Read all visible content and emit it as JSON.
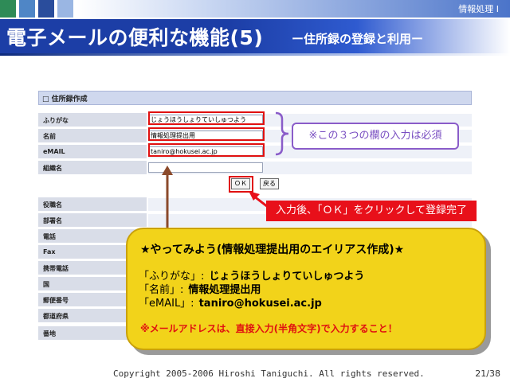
{
  "header": {
    "subject": "情報処理 I",
    "title": "電子メールの便利な機能(5)",
    "subtitle": "ー住所録の登録と利用ー",
    "square_colors": [
      "#2e8b57",
      "#4f86c6",
      "#2a4d9c",
      "#9ab6e3"
    ]
  },
  "form": {
    "section_title": "□ 住所録作成",
    "rows": [
      {
        "label": "ふりがな",
        "value": "じょうほうしょりていしゅつよう"
      },
      {
        "label": "名前",
        "value": "情報処理提出用"
      },
      {
        "label": "eMAIL",
        "value": "taniro@hokusei.ac.jp"
      },
      {
        "label": "組織名",
        "value": ""
      }
    ],
    "ok_label": "ＯＫ",
    "back_label": "戻る",
    "rows2": [
      {
        "label": "役職名"
      },
      {
        "label": "部署名"
      },
      {
        "label": "電話"
      },
      {
        "label": "Fax"
      },
      {
        "label": "携帯電話"
      },
      {
        "label": "国"
      },
      {
        "label": "郵便番号"
      },
      {
        "label": "都道府県"
      },
      {
        "label": "番地"
      }
    ]
  },
  "note": "※この３つの欄の入力は必須",
  "callout": "入力後、「ＯＫ」をクリックして登録完了",
  "exercise": {
    "title": "★やってみよう(情報処理提出用のエイリアス作成)★",
    "lines": [
      {
        "key": "「ふりがな」:",
        "value": "じょうほうしょりていしゅつよう"
      },
      {
        "key": "「名前」:",
        "value": "情報処理提出用"
      },
      {
        "key": "「eMAIL」:",
        "value": "taniro@hokusei.ac.jp"
      }
    ],
    "warning": "※メールアドレスは、直接入力(半角文字)で入力すること！"
  },
  "footer": {
    "copyright": "Copyright 2005-2006 Hiroshi Taniguchi. All rights reserved.",
    "page": "21/38"
  }
}
